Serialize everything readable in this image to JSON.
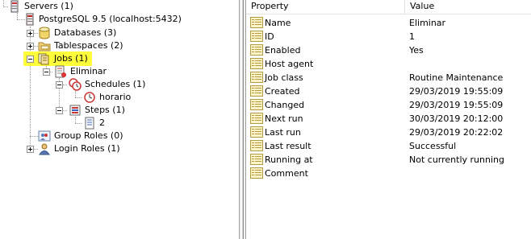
{
  "tree": {
    "servers": "Servers (1)",
    "server": "PostgreSQL 9.5 (localhost:5432)",
    "databases": "Databases (3)",
    "tablespaces": "Tablespaces (2)",
    "jobs": "Jobs (1)",
    "job": "Eliminar",
    "schedules": "Schedules (1)",
    "schedule": "horario",
    "steps": "Steps (1)",
    "step": "2",
    "group_roles": "Group Roles (0)",
    "login_roles": "Login Roles (1)"
  },
  "grid": {
    "col_property": "Property",
    "col_value": "Value",
    "rows": [
      {
        "property": "Name",
        "value": "Eliminar"
      },
      {
        "property": "ID",
        "value": "1"
      },
      {
        "property": "Enabled",
        "value": "Yes"
      },
      {
        "property": "Host agent",
        "value": ""
      },
      {
        "property": "Job class",
        "value": "Routine Maintenance"
      },
      {
        "property": "Created",
        "value": "29/03/2019 19:55:09"
      },
      {
        "property": "Changed",
        "value": "29/03/2019 19:55:09"
      },
      {
        "property": "Next run",
        "value": "30/03/2019 20:12:00"
      },
      {
        "property": "Last run",
        "value": "29/03/2019 20:22:02"
      },
      {
        "property": "Last result",
        "value": "Successful"
      },
      {
        "property": "Running at",
        "value": "Not currently running"
      },
      {
        "property": "Comment",
        "value": ""
      }
    ]
  },
  "colors": {
    "highlight": "#fffe3a"
  }
}
